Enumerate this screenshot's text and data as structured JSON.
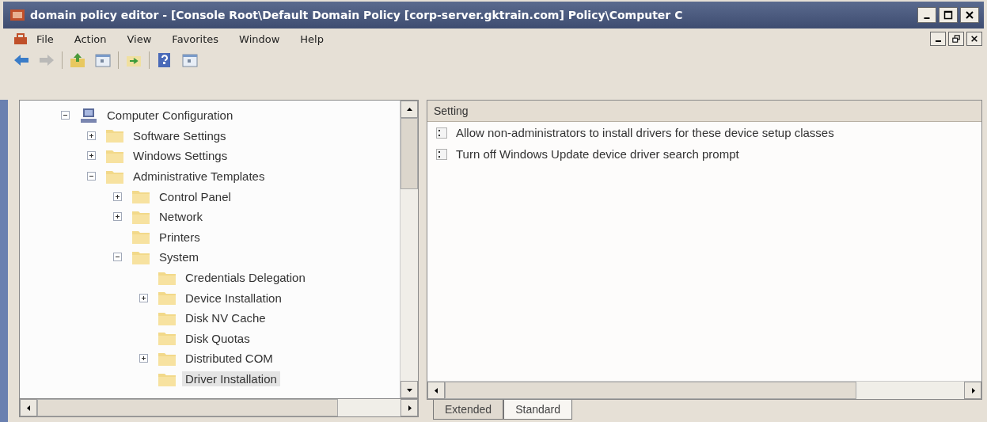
{
  "window": {
    "title": "domain policy editor - [Console Root\\Default Domain Policy [corp-server.gktrain.com] Policy\\Computer C"
  },
  "menu": [
    "File",
    "Action",
    "View",
    "Favorites",
    "Window",
    "Help"
  ],
  "toolbar": [
    {
      "kind": "back",
      "disabled": false
    },
    {
      "kind": "forward",
      "disabled": true
    },
    {
      "kind": "up",
      "disabled": false
    },
    {
      "kind": "pane",
      "disabled": false
    },
    {
      "kind": "export",
      "disabled": false
    },
    {
      "kind": "help",
      "disabled": false
    },
    {
      "kind": "pane",
      "disabled": false
    }
  ],
  "tree": [
    {
      "label": "Computer Configuration",
      "kind": "computer",
      "expanded": true,
      "selected": false,
      "children": [
        {
          "label": "Software Settings",
          "kind": "folder",
          "expanded": false,
          "selected": false
        },
        {
          "label": "Windows Settings",
          "kind": "folder",
          "expanded": false,
          "selected": false
        },
        {
          "label": "Administrative Templates",
          "kind": "folder",
          "expanded": true,
          "selected": false,
          "children": [
            {
              "label": "Control Panel",
              "kind": "folder",
              "expanded": false,
              "selected": false
            },
            {
              "label": "Network",
              "kind": "folder",
              "expanded": false,
              "selected": false
            },
            {
              "label": "Printers",
              "kind": "folder",
              "selected": false
            },
            {
              "label": "System",
              "kind": "folder",
              "expanded": true,
              "selected": false,
              "children": [
                {
                  "label": "Credentials Delegation",
                  "kind": "folder",
                  "selected": false
                },
                {
                  "label": "Device Installation",
                  "kind": "folder",
                  "expanded": false,
                  "selected": false
                },
                {
                  "label": "Disk NV Cache",
                  "kind": "folder",
                  "selected": false
                },
                {
                  "label": "Disk Quotas",
                  "kind": "folder",
                  "selected": false
                },
                {
                  "label": "Distributed COM",
                  "kind": "folder",
                  "expanded": false,
                  "selected": false
                },
                {
                  "label": "Driver Installation",
                  "kind": "folder",
                  "selected": true
                }
              ]
            }
          ]
        }
      ]
    }
  ],
  "settings": {
    "columns": [
      "Setting"
    ],
    "rows": [
      {
        "name": "Allow non-administrators to install drivers for these device setup classes"
      },
      {
        "name": "Turn off Windows Update device driver search prompt"
      }
    ]
  },
  "tabs": [
    {
      "label": "Extended",
      "selected": false
    },
    {
      "label": "Standard",
      "selected": true
    }
  ]
}
